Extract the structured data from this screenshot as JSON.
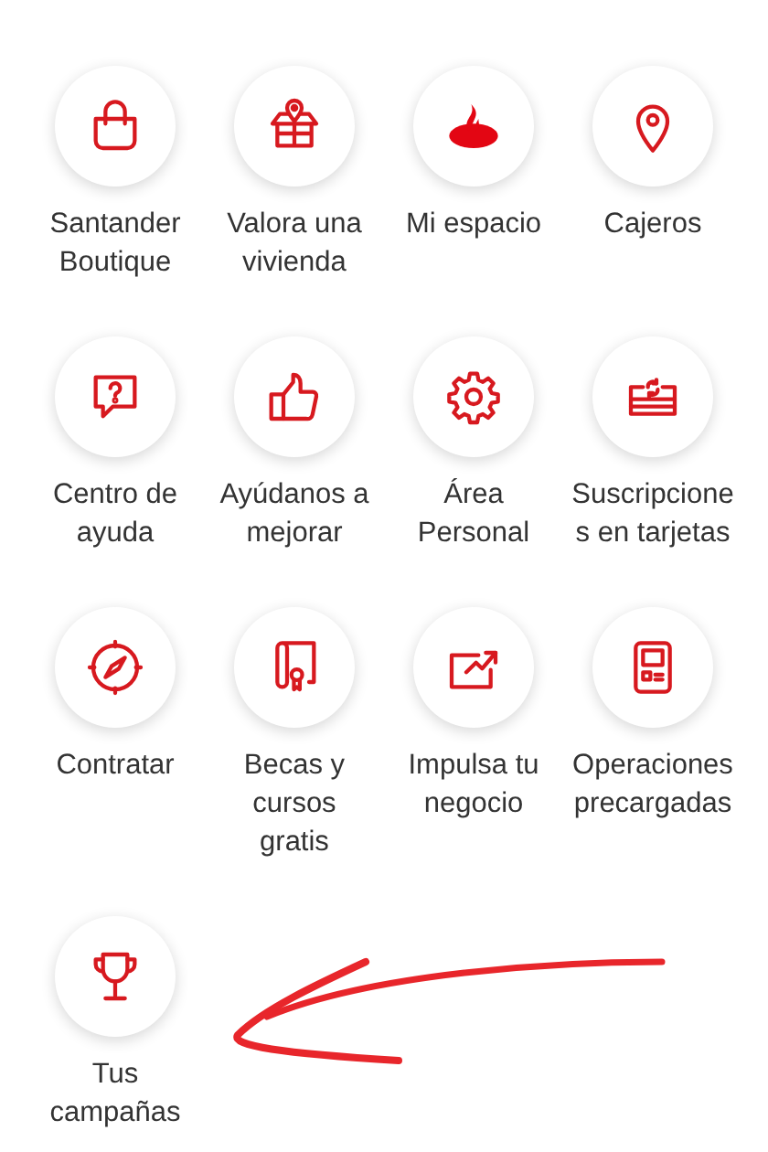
{
  "shortcuts": [
    {
      "kind": "bag",
      "label": [
        "Santander",
        "Boutique"
      ]
    },
    {
      "kind": "house",
      "label": [
        "Valora una",
        "vivienda"
      ]
    },
    {
      "kind": "flame",
      "label": [
        "Mi espacio"
      ]
    },
    {
      "kind": "pin",
      "label": [
        "Cajeros"
      ]
    },
    {
      "kind": "help",
      "label": [
        "Centro de",
        "ayuda"
      ]
    },
    {
      "kind": "thumb",
      "label": [
        "Ayúdanos a",
        "mejorar"
      ]
    },
    {
      "kind": "gear",
      "label": [
        "Área",
        "Personal"
      ]
    },
    {
      "kind": "card",
      "label": [
        "Suscripcione",
        "s en tarjetas"
      ]
    },
    {
      "kind": "compass",
      "label": [
        "Contratar"
      ]
    },
    {
      "kind": "diploma",
      "label": [
        "Becas y",
        "cursos",
        "gratis"
      ]
    },
    {
      "kind": "chart",
      "label": [
        "Impulsa tu",
        "negocio"
      ]
    },
    {
      "kind": "terminal",
      "label": [
        "Operaciones",
        "precargadas"
      ]
    },
    {
      "kind": "trophy",
      "label": [
        "Tus",
        "campañas"
      ]
    }
  ]
}
